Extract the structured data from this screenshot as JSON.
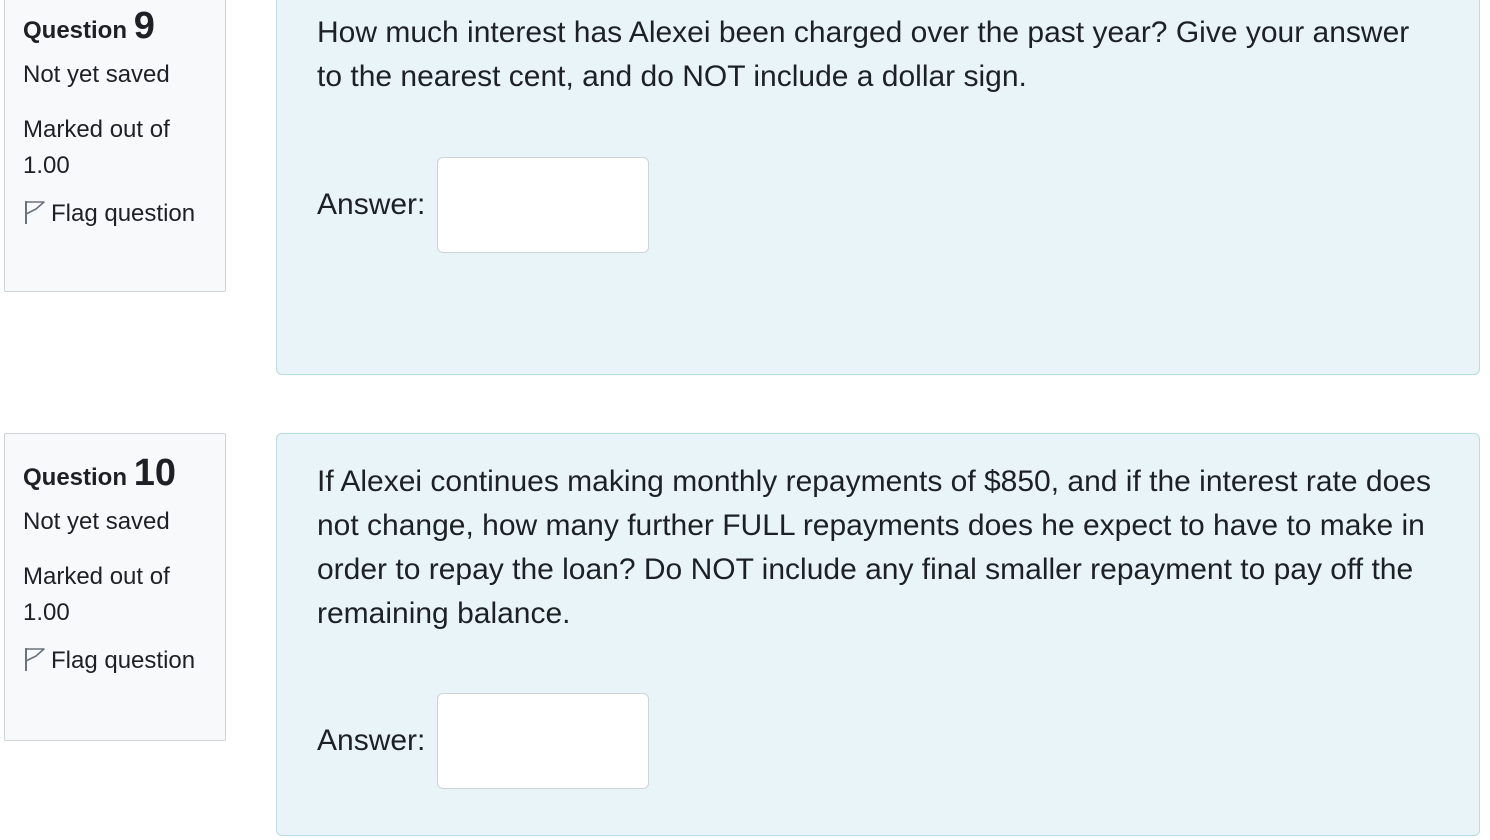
{
  "questions": [
    {
      "label": "Question",
      "number": "9",
      "state": "Not yet saved",
      "grade": "Marked out of 1.00",
      "flag_label": "Flag question",
      "flag_icon": "flag-outline-icon",
      "text": "How much interest has Alexei been charged over the past year? Give your answer to the nearest cent, and do NOT include a dollar sign.",
      "answer_label": "Answer:",
      "answer_value": ""
    },
    {
      "label": "Question",
      "number": "10",
      "state": "Not yet saved",
      "grade": "Marked out of 1.00",
      "flag_label": "Flag question",
      "flag_icon": "flag-outline-icon",
      "text": "If Alexei continues making monthly repayments of $850, and if the interest rate does not change, how many further FULL repayments does he expect to have to make in order to repay the loan? Do NOT include any final smaller repayment to pay off the remaining balance.",
      "answer_label": "Answer:",
      "answer_value": ""
    }
  ],
  "colors": {
    "info_bg": "#f8f9fa",
    "content_bg": "#e8f4f7",
    "content_border": "#b8dce2",
    "text": "#1d2125"
  }
}
